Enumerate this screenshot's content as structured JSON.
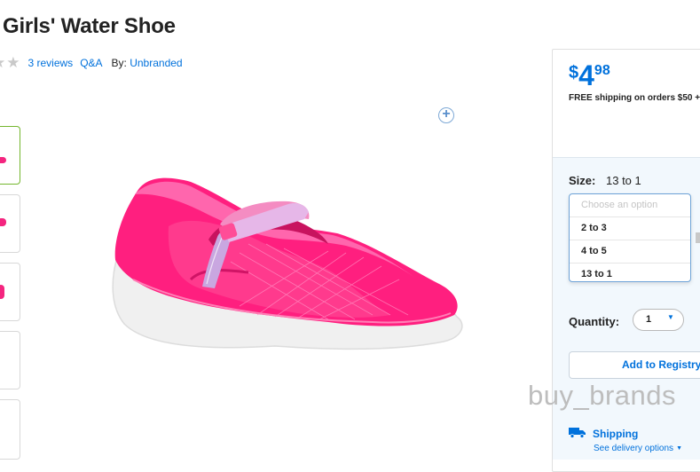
{
  "product": {
    "title": "Girls' Water Shoe",
    "reviews_link": "3 reviews",
    "qa_link": "Q&A",
    "by_label": "By:",
    "brand": "Unbranded",
    "rating_stars_filled": 0,
    "image_name": "pink-mary-jane-water-shoe"
  },
  "price": {
    "currency": "$",
    "dollars": "4",
    "cents": "98",
    "shipping_note": "FREE shipping on orders $50 +",
    "info_icon": "i"
  },
  "size": {
    "label": "Size:",
    "selected": "13 to 1",
    "placeholder": "Choose an option",
    "options": [
      "2 to 3",
      "4 to 5",
      "13 to 1"
    ]
  },
  "quantity": {
    "label": "Quantity:",
    "value": "1"
  },
  "registry_button": "Add to Registry",
  "shipping": {
    "title": "Shipping",
    "options_link": "See delivery options"
  },
  "watermark": "buy_brands",
  "colors": {
    "accent": "#0071dc",
    "shoe_pink": "#f4257f",
    "active_thumb_border": "#74b62e"
  },
  "icons": [
    "star-icon",
    "zoom-plus-icon",
    "info-icon",
    "chevron-down-icon",
    "truck-icon"
  ]
}
